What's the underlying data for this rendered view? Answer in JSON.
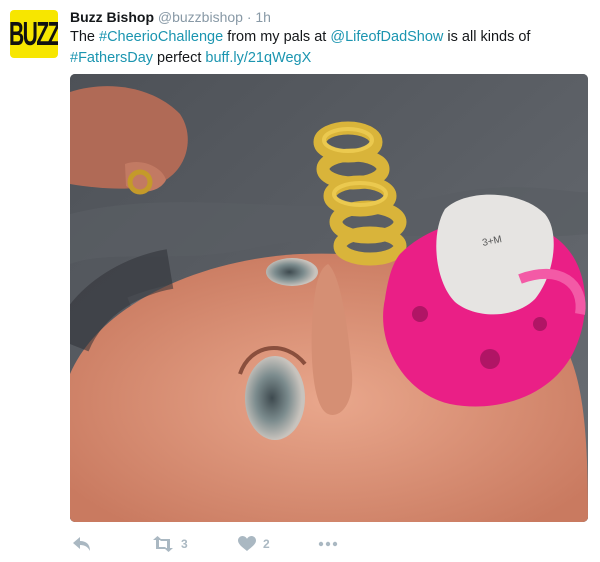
{
  "tweet": {
    "avatar_text": "BUZZ",
    "author_name": "Buzz Bishop",
    "author_handle": "@buzzbishop",
    "separator": "·",
    "time": "1h",
    "text_parts": {
      "p1": "The ",
      "hashtag1": "#CheerioChallenge",
      "p2": " from my pals at ",
      "mention": "@LifeofDadShow",
      "p3": " is all kinds of ",
      "hashtag2": "#FathersDay",
      "p4": " perfect ",
      "link": "buff.ly/21qWegX"
    },
    "pacifier_handwriting": "3+M"
  },
  "actions": {
    "reply_icon": "reply-icon",
    "retweet_icon": "retweet-icon",
    "retweet_count": "3",
    "like_icon": "heart-icon",
    "like_count": "2",
    "more_icon": "more-dots-icon"
  },
  "colors": {
    "link": "#1b95b0",
    "muted": "#8899a6",
    "avatar_bg": "#f7e600",
    "action_icon": "#aab8c2"
  }
}
